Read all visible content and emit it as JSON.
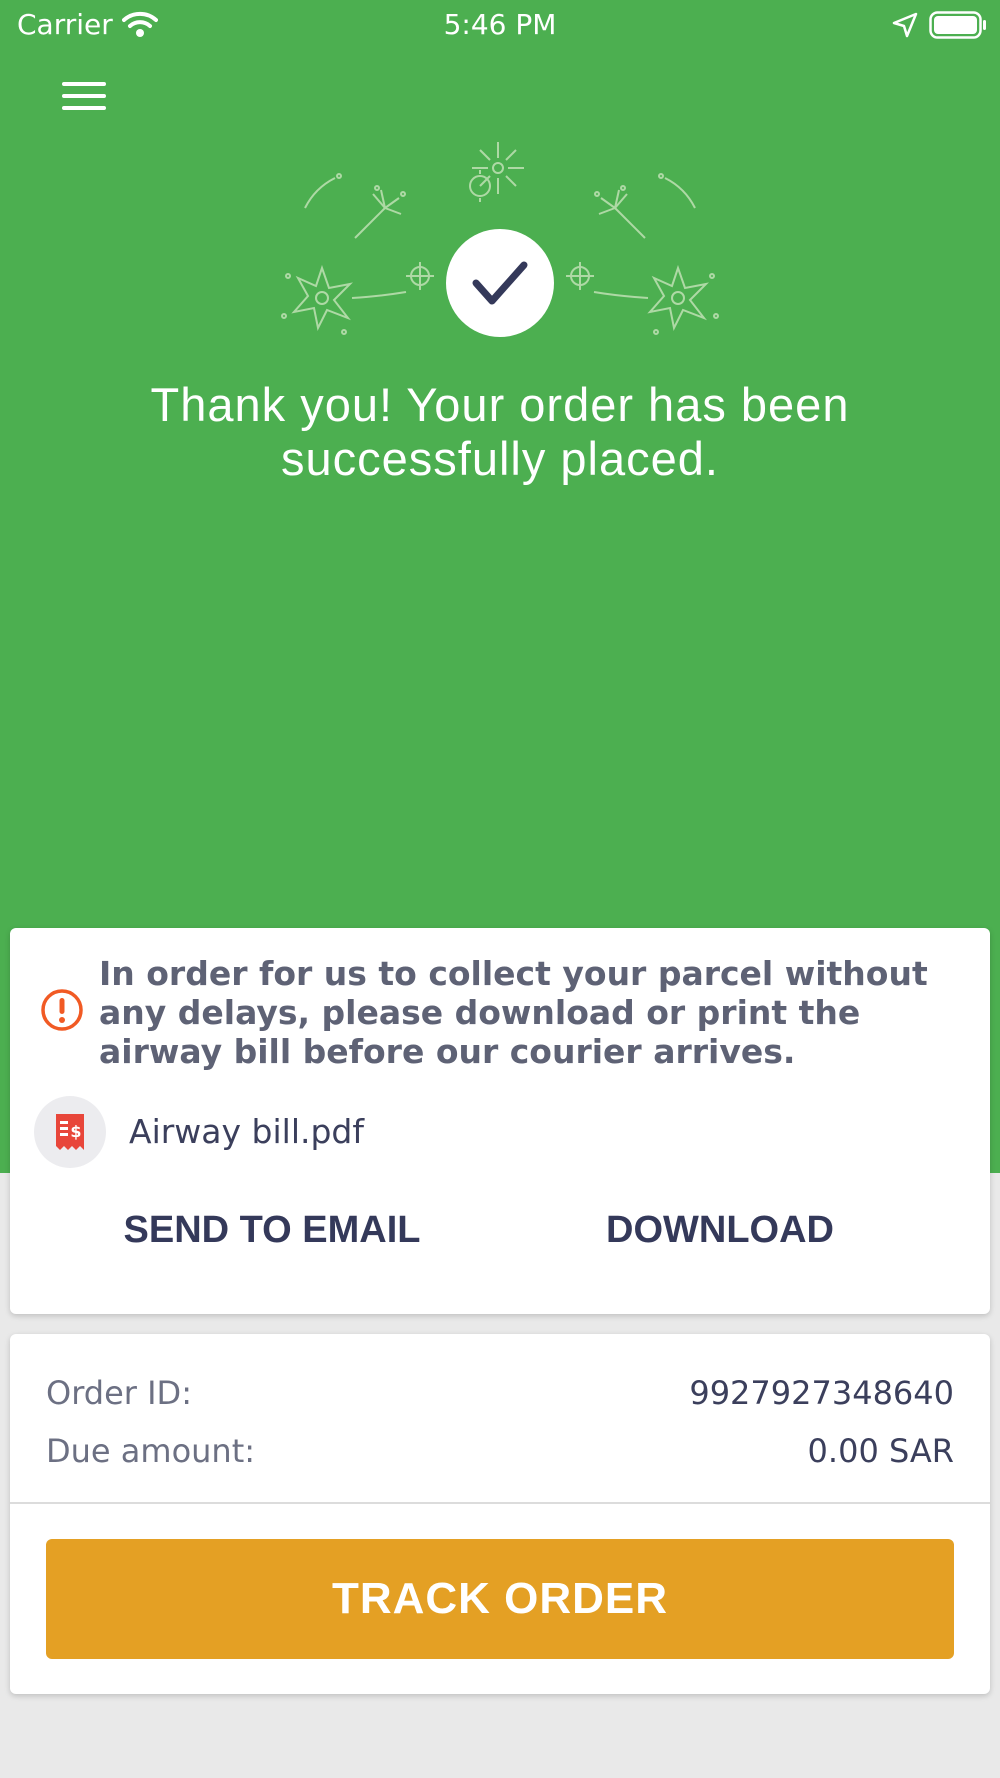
{
  "status_bar": {
    "carrier": "Carrier",
    "time": "5:46 PM"
  },
  "hero": {
    "message": "Thank you! Your order has been successfully placed."
  },
  "notice": {
    "text": "In order for us to collect your parcel without any delays, please download or print the airway bill before our courier arrives.",
    "file_name": "Airway bill.pdf",
    "send_email_label": "SEND TO EMAIL",
    "download_label": "DOWNLOAD"
  },
  "order": {
    "order_id_label": "Order ID:",
    "order_id_value": "9927927348640",
    "due_amount_label": "Due amount:",
    "due_amount_value": "0.00 SAR",
    "track_label": "TRACK ORDER"
  },
  "colors": {
    "hero_green": "#4caf50",
    "accent_orange": "#e4a024",
    "warning_orange": "#f15a24",
    "text_dark": "#34395a"
  },
  "icons": {
    "menu": "hamburger-menu-icon",
    "success": "checkmark-icon",
    "warning": "exclamation-circle-icon",
    "file": "receipt-dollar-icon"
  }
}
